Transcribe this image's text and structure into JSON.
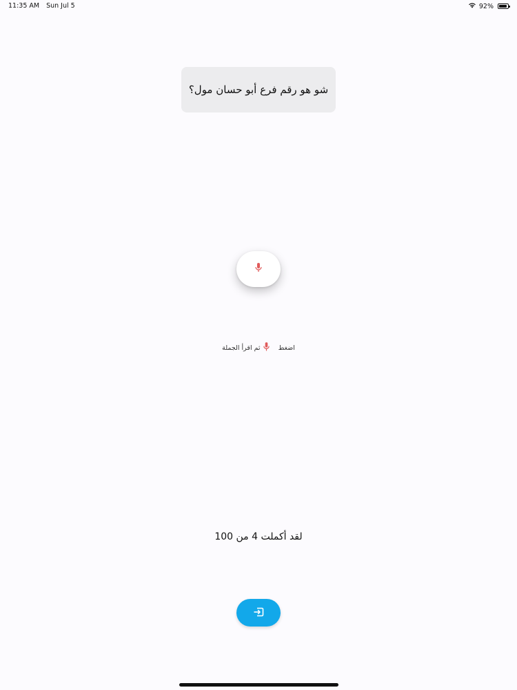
{
  "status_bar": {
    "time": "11:35 AM",
    "date": "Sun Jul 5",
    "battery_percent": "92%",
    "battery_level": 0.92,
    "wifi_icon": "wifi-icon",
    "battery_icon": "battery-icon"
  },
  "sentence": {
    "text": "شو هو رقم فرع أبو حسان مول؟"
  },
  "mic_button": {
    "icon": "microphone-icon",
    "icon_color": "#e05a5a"
  },
  "instruction": {
    "press_label": "اضغط",
    "then_read_label": "ثم اقرأ الجملة",
    "icon": "microphone-icon"
  },
  "progress": {
    "text": "لقد أكملت 4 من 100",
    "completed": 4,
    "total": 100
  },
  "exit_button": {
    "icon": "sign-in-icon",
    "color": "#12a8ea"
  }
}
